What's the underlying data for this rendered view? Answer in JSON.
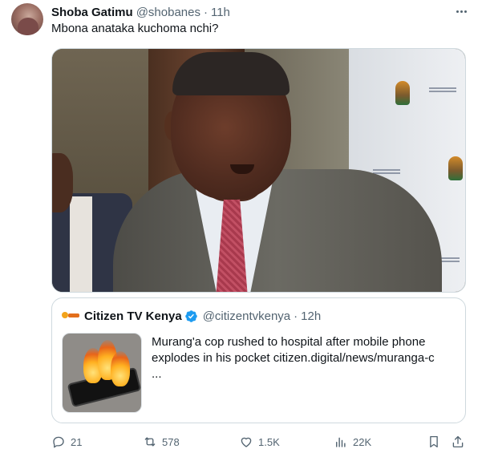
{
  "tweet": {
    "author_name": "Shoba Gatimu",
    "author_handle": "@shobanes",
    "separator": "·",
    "time": "11h",
    "text": "Mbona anataka kuchoma nchi?"
  },
  "quote": {
    "author_name": "Citizen TV Kenya",
    "author_handle": "@citizentvkenya",
    "separator": "·",
    "time": "12h",
    "text_lines": [
      "Murang'a cop rushed to hospital after mobile phone",
      "explodes in his pocket citizen.digital/news/muranga-c",
      "..."
    ]
  },
  "actions": {
    "replies": "21",
    "retweets": "578",
    "likes": "1.5K",
    "views": "22K"
  },
  "icons": {
    "more": "more-icon",
    "verified": "verified-badge-icon",
    "reply": "reply-icon",
    "retweet": "retweet-icon",
    "like": "heart-icon",
    "views": "views-chart-icon",
    "bookmark": "bookmark-icon",
    "share": "share-icon"
  },
  "colors": {
    "text_primary": "#0f1419",
    "text_secondary": "#536471",
    "verified": "#1d9bf0",
    "border": "#cfd9de"
  }
}
